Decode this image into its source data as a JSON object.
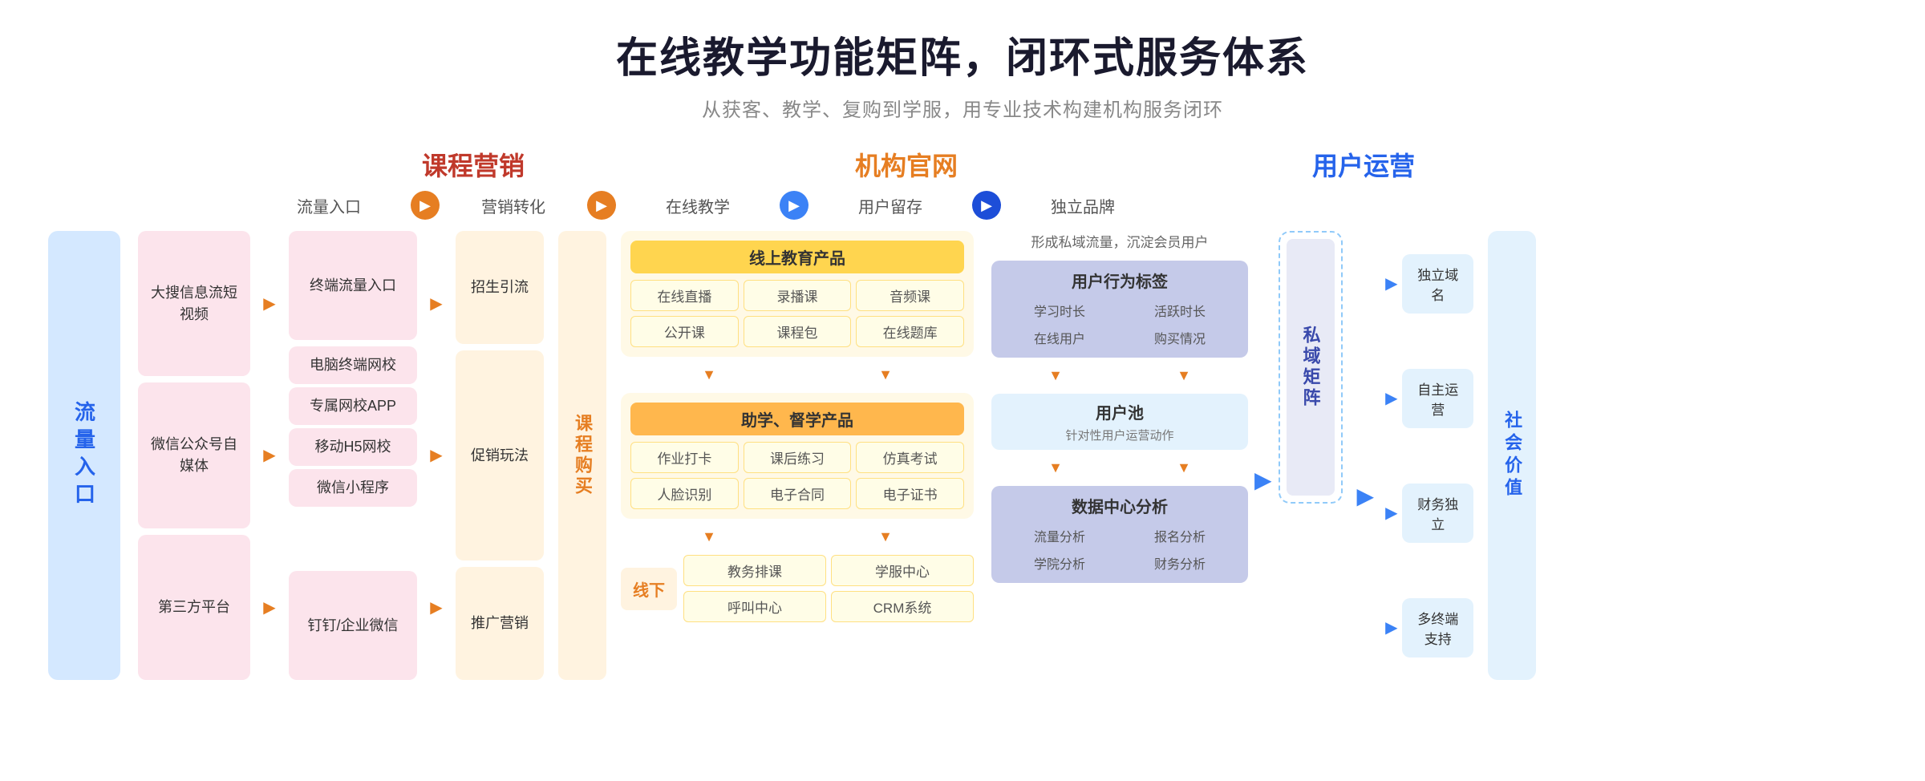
{
  "header": {
    "title": "在线教学功能矩阵，闭环式服务体系",
    "subtitle": "从获客、教学、复购到学服，用专业技术构建机构服务闭环"
  },
  "categories": {
    "marketing": "课程营销",
    "website": "机构官网",
    "user": "用户运营"
  },
  "flow_labels": {
    "traffic": "流量入口",
    "convert": "营销转化",
    "online": "在线教学",
    "retain": "用户留存",
    "brand": "独立品牌"
  },
  "left_sidebar": "流量入口",
  "traffic_sources": [
    {
      "name": "大搜信息流短视频"
    },
    {
      "name": "微信公众号自媒体"
    },
    {
      "name": "第三方平台"
    }
  ],
  "marketing": {
    "channels": {
      "terminal": "终端流量入口",
      "pc": "电脑终端网校",
      "app": "专属网校APP",
      "h5": "移动H5网校",
      "mini": "微信小程序",
      "dingding": "钉钉/企业微信"
    },
    "promos": {
      "recruit": "招生引流",
      "promote": "促销玩法",
      "marketing": "推广营销"
    }
  },
  "course_buy": "课程购买",
  "online_edu": {
    "section_title": "线上教育产品",
    "items": [
      "在线直播",
      "录播课",
      "音频课",
      "公开课",
      "课程包",
      "在线题库"
    ],
    "assist_title": "助学、督学产品",
    "assist_items": [
      "作业打卡",
      "课后练习",
      "仿真考试",
      "人脸识别",
      "电子合同",
      "电子证书"
    ],
    "offline_label": "线下",
    "offline_items": [
      "教务排课",
      "学服中心",
      "呼叫中心",
      "CRM系统"
    ]
  },
  "user_ops": {
    "private_note": "形成私域流量，沉淀会员用户",
    "behavior_title": "用户行为标签",
    "behavior_items": [
      "学习时长",
      "活跃时长",
      "在线用户",
      "购买情况"
    ],
    "pool_title": "用户池",
    "pool_subtitle": "针对性用户运营动作",
    "data_title": "数据中心分析",
    "data_items": [
      "流量分析",
      "报名分析",
      "学院分析",
      "财务分析"
    ],
    "private_domain": "私域矩阵"
  },
  "brand": {
    "items": [
      "独立域名",
      "自主运营",
      "财务独立",
      "多终端支持"
    ],
    "social_value": "社会价值"
  }
}
